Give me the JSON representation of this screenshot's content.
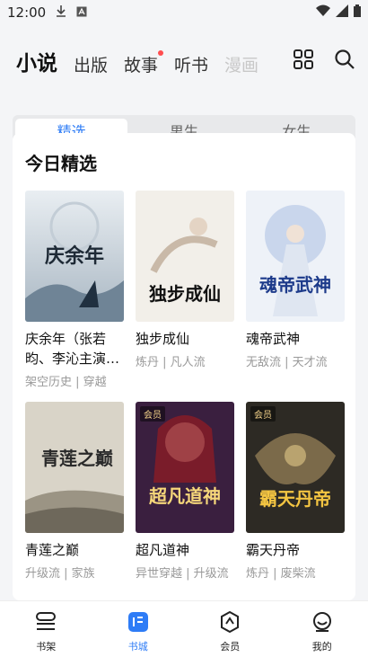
{
  "status": {
    "time": "12:00"
  },
  "topnav": {
    "tabs": [
      "小说",
      "出版",
      "故事",
      "听书",
      "漫画"
    ]
  },
  "segments": [
    "精选",
    "男生",
    "女生"
  ],
  "section": {
    "title": "今日精选"
  },
  "books": [
    {
      "title": "庆余年（张若昀、李沁主演…",
      "tags": "架空历史 | 穿越",
      "cover_text": "庆余年",
      "vip": ""
    },
    {
      "title": "独步成仙",
      "tags": "炼丹 | 凡人流",
      "cover_text": "独步成仙",
      "vip": ""
    },
    {
      "title": "魂帝武神",
      "tags": "无敌流 | 天才流",
      "cover_text": "魂帝武神",
      "vip": ""
    },
    {
      "title": "青莲之巅",
      "tags": "升级流 | 家族",
      "cover_text": "青莲之巅",
      "vip": ""
    },
    {
      "title": "超凡道神",
      "tags": "异世穿越 | 升级流",
      "cover_text": "超凡道神",
      "vip": "会员"
    },
    {
      "title": "霸天丹帝",
      "tags": "炼丹 | 废柴流",
      "cover_text": "霸天丹帝",
      "vip": "会员"
    }
  ],
  "bottom": {
    "items": [
      "书架",
      "书城",
      "会员",
      "我的"
    ]
  },
  "colors": {
    "accent": "#2e7cf6",
    "badge": "#ff4d4f"
  }
}
